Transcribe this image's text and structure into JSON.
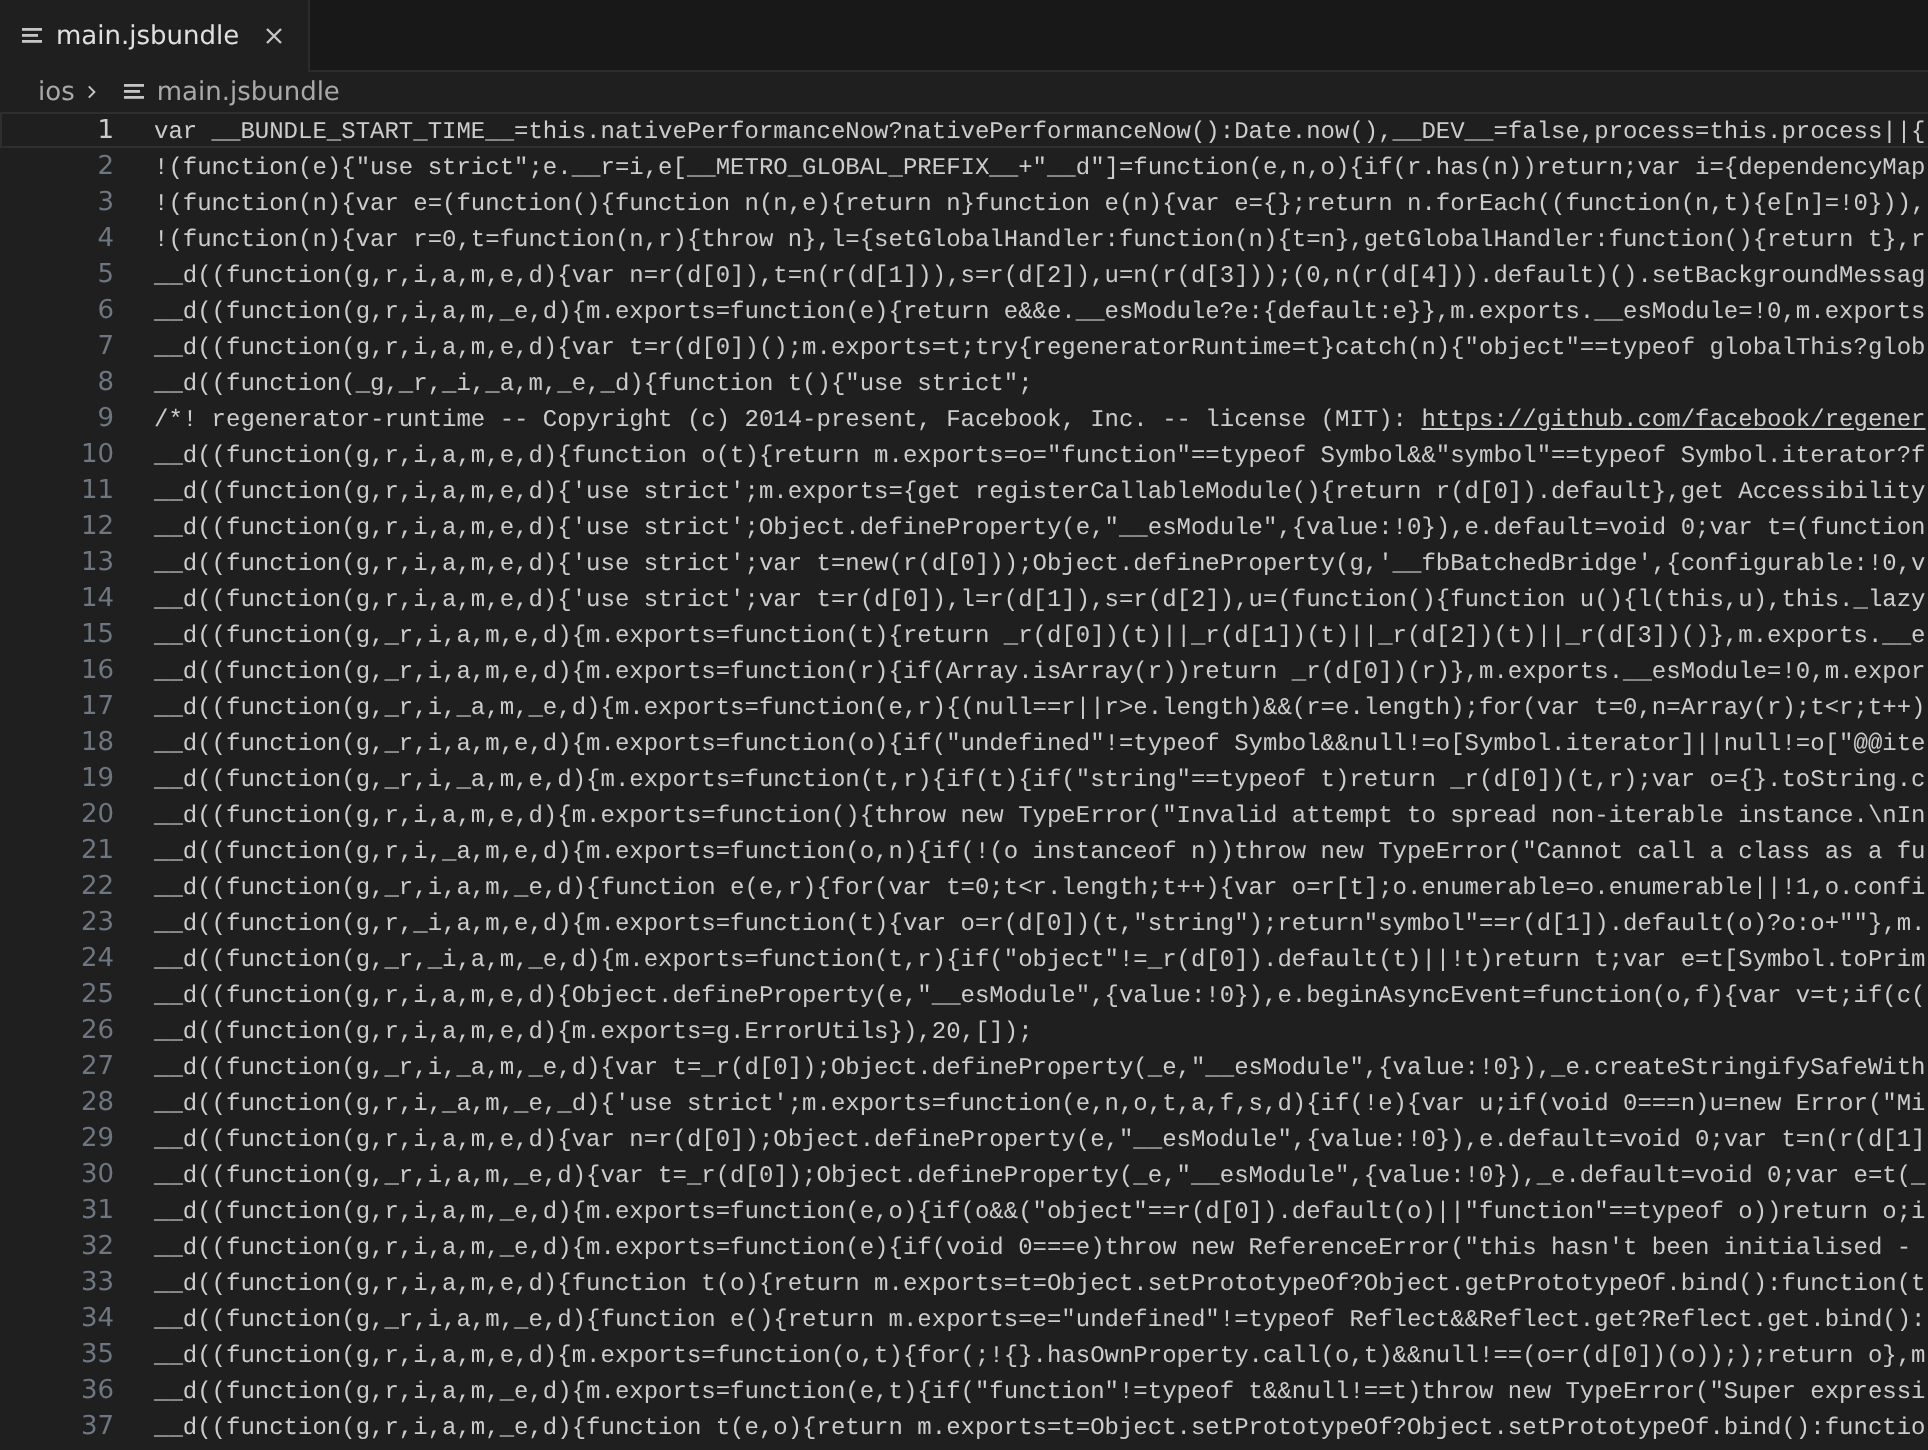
{
  "tabs": [
    {
      "label": "main.jsbundle",
      "selected": true
    }
  ],
  "breadcrumb": [
    {
      "label": "ios",
      "kind": "folder"
    },
    {
      "label": "main.jsbundle",
      "kind": "file"
    }
  ],
  "editor": {
    "lines": [
      {
        "number": "1",
        "current": true,
        "text": "var __BUNDLE_START_TIME__=this.nativePerformanceNow?nativePerformanceNow():Date.now(),__DEV__=false,process=this.process||{"
      },
      {
        "number": "2",
        "current": false,
        "text": "!(function(e){\"use strict\";e.__r=i,e[__METRO_GLOBAL_PREFIX__+\"__d\"]=function(e,n,o){if(r.has(n))return;var i={dependencyMap"
      },
      {
        "number": "3",
        "current": false,
        "text": "!(function(n){var e=(function(){function n(n,e){return n}function e(n){var e={};return n.forEach((function(n,t){e[n]=!0})),"
      },
      {
        "number": "4",
        "current": false,
        "text": "!(function(n){var r=0,t=function(n,r){throw n},l={setGlobalHandler:function(n){t=n},getGlobalHandler:function(){return t},r"
      },
      {
        "number": "5",
        "current": false,
        "text": "__d((function(g,r,i,a,m,e,d){var n=r(d[0]),t=n(r(d[1])),s=r(d[2]),u=n(r(d[3]));(0,n(r(d[4])).default)().setBackgroundMessag"
      },
      {
        "number": "6",
        "current": false,
        "text": "__d((function(g,r,i,a,m,_e,d){m.exports=function(e){return e&&e.__esModule?e:{default:e}},m.exports.__esModule=!0,m.exports"
      },
      {
        "number": "7",
        "current": false,
        "text": "__d((function(g,r,i,a,m,e,d){var t=r(d[0])();m.exports=t;try{regeneratorRuntime=t}catch(n){\"object\"==typeof globalThis?glob"
      },
      {
        "number": "8",
        "current": false,
        "text": "__d((function(_g,_r,_i,_a,m,_e,_d){function t(){\"use strict\";"
      },
      {
        "number": "9",
        "current": false,
        "text": "/*! regenerator-runtime -- Copyright (c) 2014-present, Facebook, Inc. -- license (MIT): ",
        "link": "https://github.com/facebook/regener"
      },
      {
        "number": "10",
        "current": false,
        "text": "__d((function(g,r,i,a,m,e,d){function o(t){return m.exports=o=\"function\"==typeof Symbol&&\"symbol\"==typeof Symbol.iterator?f"
      },
      {
        "number": "11",
        "current": false,
        "text": "__d((function(g,r,i,a,m,e,d){'use strict';m.exports={get registerCallableModule(){return r(d[0]).default},get Accessibility"
      },
      {
        "number": "12",
        "current": false,
        "text": "__d((function(g,r,i,a,m,e,d){'use strict';Object.defineProperty(e,\"__esModule\",{value:!0}),e.default=void 0;var t=(function"
      },
      {
        "number": "13",
        "current": false,
        "text": "__d((function(g,r,i,a,m,e,d){'use strict';var t=new(r(d[0]));Object.defineProperty(g,'__fbBatchedBridge',{configurable:!0,v"
      },
      {
        "number": "14",
        "current": false,
        "text": "__d((function(g,r,i,a,m,e,d){'use strict';var t=r(d[0]),l=r(d[1]),s=r(d[2]),u=(function(){function u(){l(this,u),this._lazy"
      },
      {
        "number": "15",
        "current": false,
        "text": "__d((function(g,_r,i,a,m,e,d){m.exports=function(t){return _r(d[0])(t)||_r(d[1])(t)||_r(d[2])(t)||_r(d[3])()},m.exports.__e"
      },
      {
        "number": "16",
        "current": false,
        "text": "__d((function(g,_r,i,a,m,e,d){m.exports=function(r){if(Array.isArray(r))return _r(d[0])(r)},m.exports.__esModule=!0,m.expor"
      },
      {
        "number": "17",
        "current": false,
        "text": "__d((function(g,_r,i,_a,m,_e,d){m.exports=function(e,r){(null==r||r>e.length)&&(r=e.length);for(var t=0,n=Array(r);t<r;t++)"
      },
      {
        "number": "18",
        "current": false,
        "text": "__d((function(g,_r,i,a,m,e,d){m.exports=function(o){if(\"undefined\"!=typeof Symbol&&null!=o[Symbol.iterator]||null!=o[\"@@ite"
      },
      {
        "number": "19",
        "current": false,
        "text": "__d((function(g,_r,i,_a,m,e,d){m.exports=function(t,r){if(t){if(\"string\"==typeof t)return _r(d[0])(t,r);var o={}.toString.c"
      },
      {
        "number": "20",
        "current": false,
        "text": "__d((function(g,r,i,a,m,e,d){m.exports=function(){throw new TypeError(\"Invalid attempt to spread non-iterable instance.\\nIn"
      },
      {
        "number": "21",
        "current": false,
        "text": "__d((function(g,r,i,_a,m,e,d){m.exports=function(o,n){if(!(o instanceof n))throw new TypeError(\"Cannot call a class as a fu"
      },
      {
        "number": "22",
        "current": false,
        "text": "__d((function(g,_r,i,a,m,_e,d){function e(e,r){for(var t=0;t<r.length;t++){var o=r[t];o.enumerable=o.enumerable||!1,o.confi"
      },
      {
        "number": "23",
        "current": false,
        "text": "__d((function(g,r,_i,a,m,e,d){m.exports=function(t){var o=r(d[0])(t,\"string\");return\"symbol\"==r(d[1]).default(o)?o:o+\"\"},m."
      },
      {
        "number": "24",
        "current": false,
        "text": "__d((function(g,_r,_i,a,m,_e,d){m.exports=function(t,r){if(\"object\"!=_r(d[0]).default(t)||!t)return t;var e=t[Symbol.toPrim"
      },
      {
        "number": "25",
        "current": false,
        "text": "__d((function(g,r,i,a,m,e,d){Object.defineProperty(e,\"__esModule\",{value:!0}),e.beginAsyncEvent=function(o,f){var v=t;if(c("
      },
      {
        "number": "26",
        "current": false,
        "text": "__d((function(g,r,i,a,m,e,d){m.exports=g.ErrorUtils}),20,[]);"
      },
      {
        "number": "27",
        "current": false,
        "text": "__d((function(g,_r,i,_a,m,_e,d){var t=_r(d[0]);Object.defineProperty(_e,\"__esModule\",{value:!0}),_e.createStringifySafeWith"
      },
      {
        "number": "28",
        "current": false,
        "text": "__d((function(g,r,i,_a,m,_e,_d){'use strict';m.exports=function(e,n,o,t,a,f,s,d){if(!e){var u;if(void 0===n)u=new Error(\"Mi"
      },
      {
        "number": "29",
        "current": false,
        "text": "__d((function(g,r,i,a,m,e,d){var n=r(d[0]);Object.defineProperty(e,\"__esModule\",{value:!0}),e.default=void 0;var t=n(r(d[1]"
      },
      {
        "number": "30",
        "current": false,
        "text": "__d((function(g,_r,i,a,m,_e,d){var t=_r(d[0]);Object.defineProperty(_e,\"__esModule\",{value:!0}),_e.default=void 0;var e=t(_"
      },
      {
        "number": "31",
        "current": false,
        "text": "__d((function(g,r,i,a,m,_e,d){m.exports=function(e,o){if(o&&(\"object\"==r(d[0]).default(o)||\"function\"==typeof o))return o;i"
      },
      {
        "number": "32",
        "current": false,
        "text": "__d((function(g,r,i,a,m,_e,d){m.exports=function(e){if(void 0===e)throw new ReferenceError(\"this hasn't been initialised -"
      },
      {
        "number": "33",
        "current": false,
        "text": "__d((function(g,r,i,a,m,e,d){function t(o){return m.exports=t=Object.setPrototypeOf?Object.getPrototypeOf.bind():function(t"
      },
      {
        "number": "34",
        "current": false,
        "text": "__d((function(g,_r,i,a,m,_e,d){function e(){return m.exports=e=\"undefined\"!=typeof Reflect&&Reflect.get?Reflect.get.bind():"
      },
      {
        "number": "35",
        "current": false,
        "text": "__d((function(g,r,i,a,m,e,d){m.exports=function(o,t){for(;!{}.hasOwnProperty.call(o,t)&&null!==(o=r(d[0])(o)););return o},m"
      },
      {
        "number": "36",
        "current": false,
        "text": "__d((function(g,r,i,a,m,_e,d){m.exports=function(e,t){if(\"function\"!=typeof t&&null!==t)throw new TypeError(\"Super expressi"
      },
      {
        "number": "37",
        "current": false,
        "text": "__d((function(g,r,i,a,m,_e,d){function t(e,o){return m.exports=t=Object.setPrototypeOf?Object.setPrototypeOf.bind():functio"
      }
    ]
  }
}
